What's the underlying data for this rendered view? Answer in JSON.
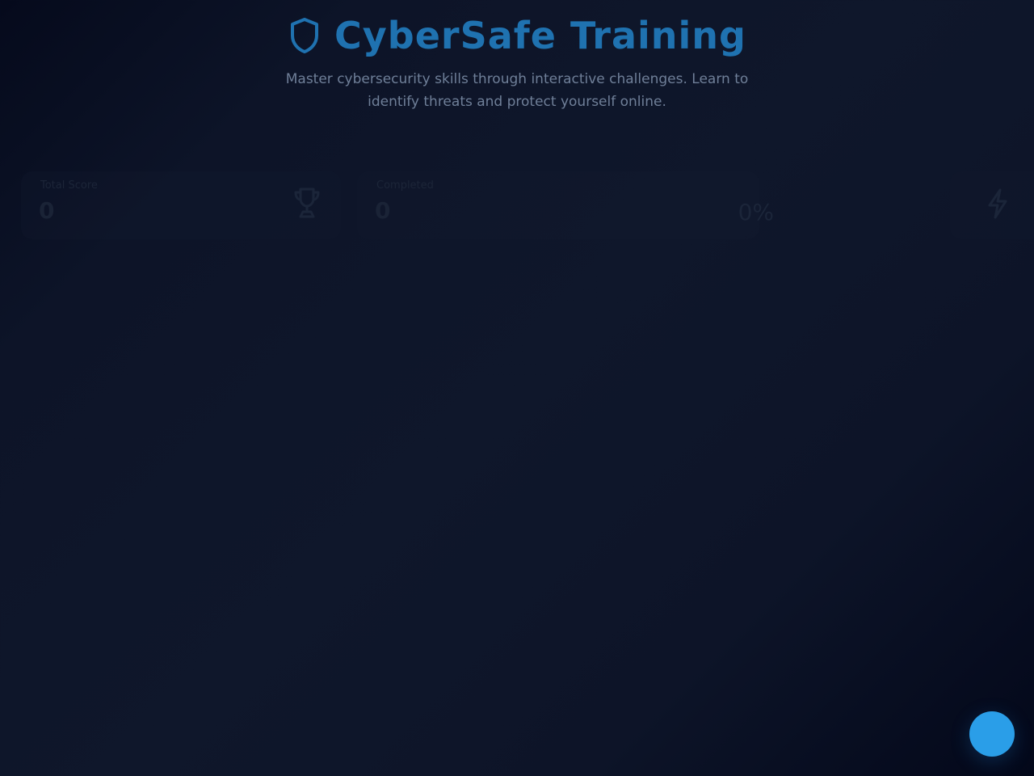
{
  "header": {
    "title": "CyberSafe Training",
    "subtitle": "Master cybersecurity skills through interactive challenges. Learn to identify threats and protect yourself online.",
    "logo_icon": "shield-icon"
  },
  "stats": {
    "total_score": {
      "label": "Total Score",
      "value": "0",
      "icon": "trophy-icon"
    },
    "completed": {
      "label": "Completed",
      "value": "0",
      "percent": "0%"
    },
    "extra": {
      "icon": "bolt-icon"
    }
  },
  "fab": {
    "icon": "help-icon"
  },
  "colors": {
    "title": "#1f72b0",
    "subtitle": "#6f7f98",
    "accent": "#2a9ee8",
    "background": "#0f172b"
  }
}
